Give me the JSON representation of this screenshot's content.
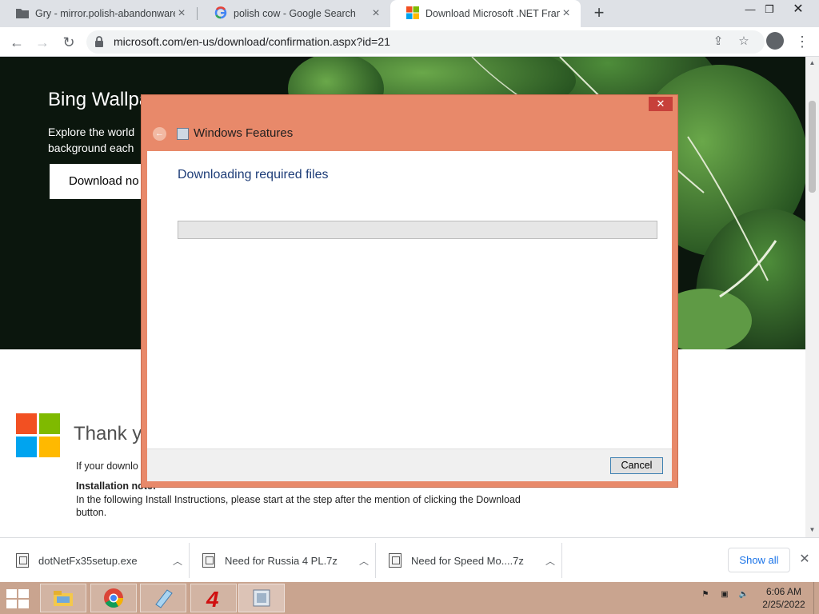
{
  "browser": {
    "tabs": [
      {
        "label": "Gry - mirror.polish-abandonware",
        "icon": "folder-icon",
        "active": false
      },
      {
        "label": "polish cow - Google Search",
        "icon": "google-icon",
        "active": false
      },
      {
        "label": "Download Microsoft .NET Frame",
        "icon": "microsoft-icon",
        "active": true
      }
    ],
    "new_tab": "+",
    "url": "microsoft.com/en-us/download/confirmation.aspx?id=21",
    "icons": [
      "back-icon",
      "forward-icon",
      "reload-icon",
      "lock-icon",
      "share-icon",
      "star-icon",
      "profile-icon",
      "menu-icon"
    ]
  },
  "page": {
    "hero_title": "Bing Wallpa",
    "hero_desc": "Explore the world background each",
    "hero_button": "Download no",
    "thank_you": "Thank yo",
    "if_download": "If your downlo",
    "install_note": "Installation note:",
    "install_text": "In the following Install Instructions, please start at the step after the mention of clicking the Download button.",
    "logo_colors": [
      "#f25022",
      "#7fba00",
      "#00a4ef",
      "#ffb900"
    ]
  },
  "dialog": {
    "title": "Windows Features",
    "heading": "Downloading required files",
    "progress": 0,
    "cancel": "Cancel",
    "frame_color": "#e8896a"
  },
  "downloads": {
    "items": [
      {
        "name": "dotNetFx35setup.exe"
      },
      {
        "name": "Need for Russia 4 PL.7z"
      },
      {
        "name": "Need for Speed Mo....7z"
      }
    ],
    "show_all": "Show all"
  },
  "taskbar": {
    "apps": [
      "file-explorer-icon",
      "chrome-icon",
      "notepad-icon",
      "nfr4-icon",
      "windows-features-icon"
    ],
    "time": "6:06 AM",
    "date": "2/25/2022"
  }
}
